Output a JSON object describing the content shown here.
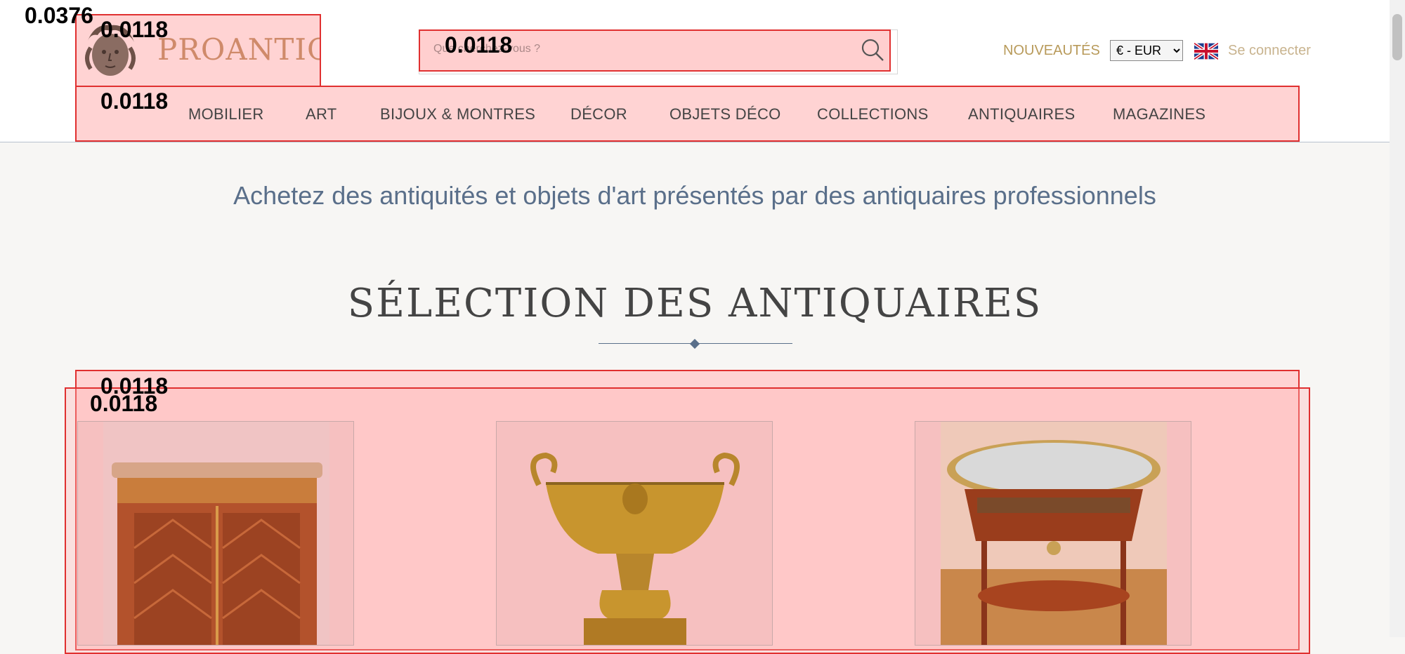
{
  "header": {
    "logo_text": "PROANTIC",
    "search_placeholder": "Que cherchez-vous ?",
    "new_label": "NOUVEAUTÉS",
    "currency": "€ - EUR",
    "login_label": "Se connecter"
  },
  "nav": {
    "items": [
      "MOBILIER",
      "ART",
      "BIJOUX & MONTRES",
      "DÉCOR",
      "OBJETS DÉCO",
      "COLLECTIONS",
      "ANTIQUAIRES",
      "MAGAZINES"
    ]
  },
  "main": {
    "tagline": "Achetez des antiquités et objets d'art présentés par des antiquaires professionnels",
    "section_title": "SÉLECTION DES ANTIQUAIRES"
  },
  "products": [
    {
      "image": "marquetry-cabinet"
    },
    {
      "image": "gilt-bronze-jardiniere"
    },
    {
      "image": "oval-marble-side-table"
    }
  ],
  "overlay_labels": {
    "top_left": "0.0376",
    "logo": "0.0118",
    "search": "0.0118",
    "nav": "0.0118",
    "products_outer": "0.0118",
    "products_inner": "0.0118"
  },
  "colors": {
    "highlight_fill": "#ffd3d3",
    "highlight_border": "#e03030",
    "accent_gold": "#b89a5a",
    "tagline_blue": "#5a6f8a"
  }
}
